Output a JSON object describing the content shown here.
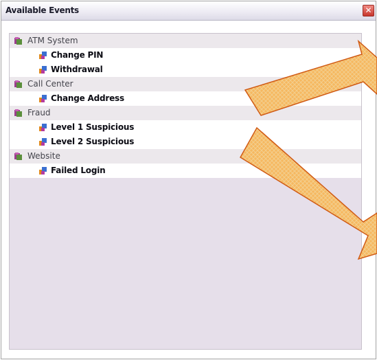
{
  "window": {
    "title": "Available Events",
    "close_label": "✕"
  },
  "groups": [
    {
      "label": "ATM System",
      "items": [
        "Change PIN",
        "Withdrawal"
      ]
    },
    {
      "label": "Call Center",
      "items": [
        "Change Address"
      ]
    },
    {
      "label": "Fraud",
      "items": [
        "Level 1 Suspicious",
        "Level 2 Suspicious"
      ]
    },
    {
      "label": "Website",
      "items": [
        "Failed Login"
      ]
    }
  ]
}
